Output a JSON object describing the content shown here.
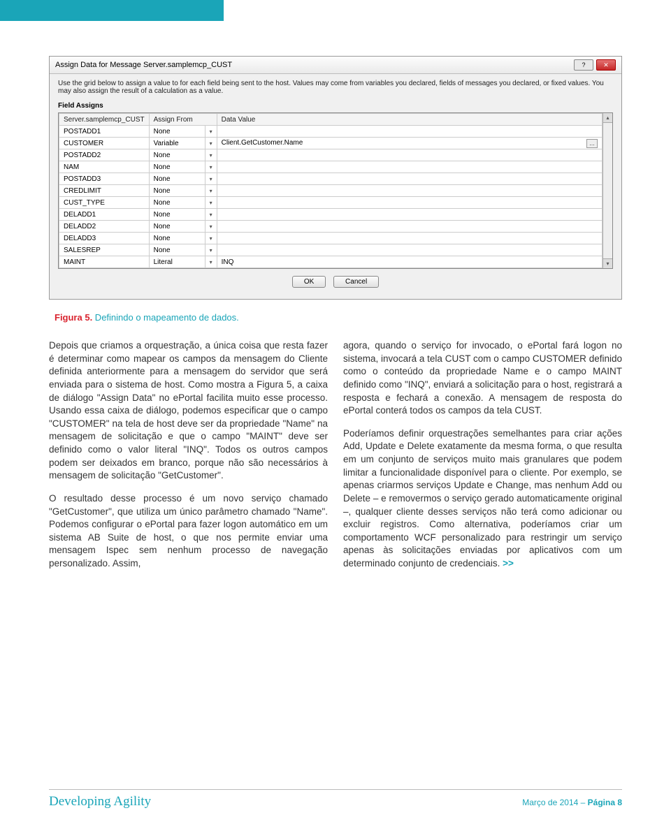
{
  "dialog": {
    "title": "Assign Data for Message Server.samplemcp_CUST",
    "help_icon": "?",
    "close_icon": "✕",
    "instructions": "Use the grid below to assign a value to for each field being sent to the host. Values may come from variables you declared, fields of messages you declared, or fixed values. You may also assign the result of a calculation as a value.",
    "section_label": "Field Assigns",
    "headers": {
      "field": "Server.samplemcp_CUST",
      "assign": "Assign From",
      "value": "Data Value"
    },
    "rows": [
      {
        "field": "POSTADD1",
        "assign": "None",
        "value": ""
      },
      {
        "field": "CUSTOMER",
        "assign": "Variable",
        "value": "Client.GetCustomer.Name",
        "ell": true
      },
      {
        "field": "POSTADD2",
        "assign": "None",
        "value": ""
      },
      {
        "field": "NAM",
        "assign": "None",
        "value": ""
      },
      {
        "field": "POSTADD3",
        "assign": "None",
        "value": ""
      },
      {
        "field": "CREDLIMIT",
        "assign": "None",
        "value": ""
      },
      {
        "field": "CUST_TYPE",
        "assign": "None",
        "value": ""
      },
      {
        "field": "DELADD1",
        "assign": "None",
        "value": ""
      },
      {
        "field": "DELADD2",
        "assign": "None",
        "value": ""
      },
      {
        "field": "DELADD3",
        "assign": "None",
        "value": ""
      },
      {
        "field": "SALESREP",
        "assign": "None",
        "value": ""
      },
      {
        "field": "MAINT",
        "assign": "Literal",
        "value": "INQ"
      }
    ],
    "ok": "OK",
    "cancel": "Cancel",
    "scroll_up": "▴",
    "scroll_down": "▾",
    "dd": "▾"
  },
  "caption": {
    "strong": "Figura 5.",
    "rest": " Definindo o mapeamento de dados."
  },
  "paras": {
    "l1": "Depois que criamos a orquestração, a única coisa que resta fazer é determinar como mapear os campos da mensagem do Cliente definida anteriormente para a mensagem do servidor que será enviada para o sistema de host. Como mostra a Figura 5, a caixa de diálogo \"Assign Data\" no ePortal facilita muito esse processo. Usando essa caixa de diálogo, podemos especificar que o campo \"CUSTOMER\" na tela de host deve ser da propriedade \"Name\" na mensagem de solicitação e que o campo \"MAINT\" deve ser definido como o valor literal \"INQ\". Todos os outros campos podem ser deixados em branco, porque não são necessários à mensagem de solicitação \"GetCustomer\".",
    "l2": "O resultado desse processo é um novo serviço chamado \"GetCustomer\", que utiliza um único parâmetro chamado \"Name\". Podemos configurar o ePortal para fazer logon automático em um sistema AB Suite de host, o que nos permite enviar uma mensagem Ispec sem nenhum processo de navegação personalizado. Assim,",
    "r1": "agora, quando o serviço for invocado, o ePortal fará logon no sistema, invocará a tela CUST com o campo CUSTOMER definido como o conteúdo da propriedade Name e o campo MAINT definido como \"INQ\", enviará a solicitação para o host, registrará a resposta e fechará a conexão. A mensagem de resposta do ePortal conterá todos os campos da tela CUST.",
    "r2a": "Poderíamos definir orquestrações semelhantes para criar ações Add, Update e Delete exatamente da mesma forma, o que resulta em um conjunto de serviços muito mais granulares que podem limitar a funcionalidade disponível para o cliente. Por exemplo, se apenas criarmos serviços Update e Change, mas nenhum Add ou Delete – e removermos o serviço gerado automaticamente original –, qualquer cliente desses serviços não terá como adicionar ou excluir registros. Como alternativa, poderíamos criar um comportamento WCF personalizado para restringir um serviço apenas às solicitações enviadas por aplicativos com um determinado conjunto de credenciais.  ",
    "more": ">>"
  },
  "footer": {
    "left": "Developing Agility",
    "right_a": "Março de 2014 – ",
    "right_b": "Página 8"
  }
}
